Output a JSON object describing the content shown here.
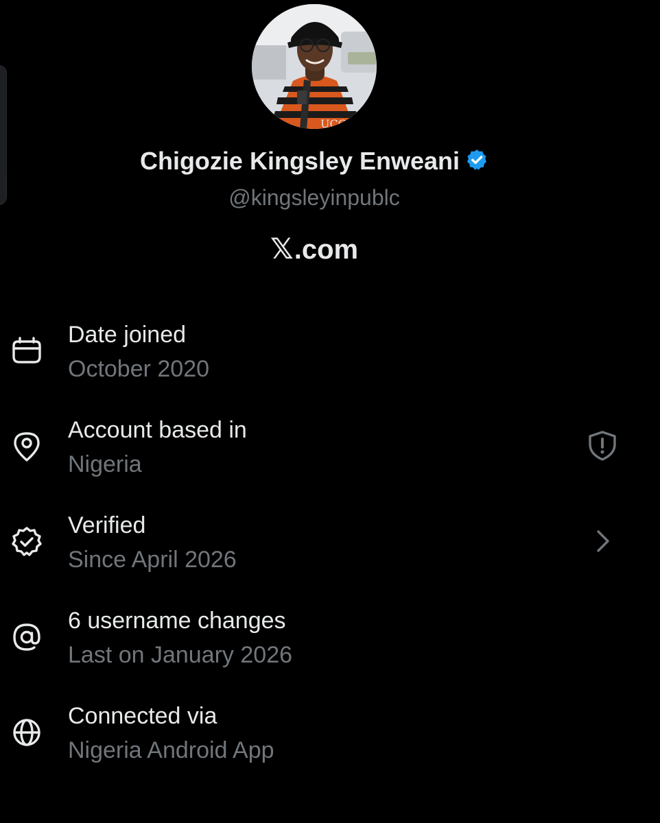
{
  "profile": {
    "display_name": "Chigozie Kingsley Enweani",
    "handle": "@kingsleyinpublc",
    "domain_mark": "𝕏",
    "domain_suffix": ".com",
    "avatar_icon": "profile-photo",
    "verified_icon": "verified-badge-icon",
    "verified_color": "#1d9bf0"
  },
  "rows": [
    {
      "icon": "calendar-icon",
      "title": "Date joined",
      "value": "October 2020"
    },
    {
      "icon": "location-pin-icon",
      "title": "Account based in",
      "value": "Nigeria",
      "trailing_icon": "shield-alert-icon"
    },
    {
      "icon": "verified-check-icon",
      "title": "Verified",
      "value": "Since April 2026",
      "trailing_icon": "chevron-right-icon"
    },
    {
      "icon": "at-sign-icon",
      "title": "6 username changes",
      "value": "Last on January 2026"
    },
    {
      "icon": "globe-icon",
      "title": "Connected via",
      "value": "Nigeria Android App"
    }
  ],
  "colors": {
    "background": "#000000",
    "primary_text": "#e7e9ea",
    "secondary_text": "#71767b"
  }
}
